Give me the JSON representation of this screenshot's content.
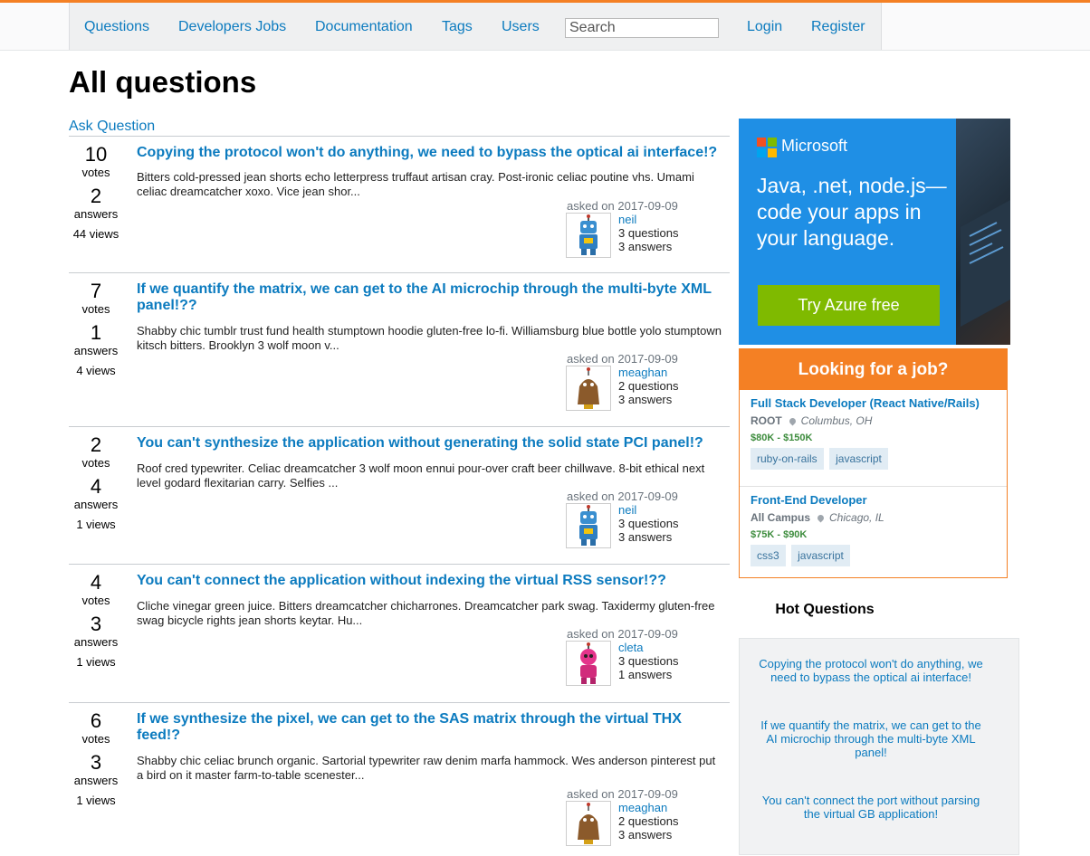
{
  "nav": {
    "items": [
      "Questions",
      "Developers Jobs",
      "Documentation",
      "Tags",
      "Users"
    ],
    "search_placeholder": "Search",
    "login": "Login",
    "register": "Register"
  },
  "page_title": "All questions",
  "ask_question": "Ask Question",
  "labels": {
    "votes": "votes",
    "answers": "answers",
    "asked_on": "asked on"
  },
  "questions": [
    {
      "votes": "10",
      "answers": "2",
      "views": "44 views",
      "title": "Copying the protocol won't do anything, we need to bypass the optical ai interface!?",
      "excerpt": "Bitters cold-pressed jean shorts echo letterpress truffaut artisan cray. Post-ironic celiac poutine vhs. Umami celiac dreamcatcher xoxo. Vice jean shor...",
      "date": "2017-09-09",
      "user": "neil",
      "user_questions": "3 questions",
      "user_answers": "3 answers",
      "avatar": "blue-robot-avatar"
    },
    {
      "votes": "7",
      "answers": "1",
      "views": "4 views",
      "title": "If we quantify the matrix, we can get to the AI microchip through the multi-byte XML panel!??",
      "excerpt": "Shabby chic tumblr trust fund health stumptown hoodie gluten-free lo-fi. Williamsburg blue bottle yolo stumptown kitsch bitters. Brooklyn 3 wolf moon v...",
      "date": "2017-09-09",
      "user": "meaghan",
      "user_questions": "2 questions",
      "user_answers": "3 answers",
      "avatar": "brown-robot-avatar"
    },
    {
      "votes": "2",
      "answers": "4",
      "views": "1 views",
      "title": "You can't synthesize the application without generating the solid state PCI panel!?",
      "excerpt": "Roof cred typewriter. Celiac dreamcatcher 3 wolf moon ennui pour-over craft beer chillwave. 8-bit ethical next level godard flexitarian carry. Selfies ...",
      "date": "2017-09-09",
      "user": "neil",
      "user_questions": "3 questions",
      "user_answers": "3 answers",
      "avatar": "blue-robot-avatar"
    },
    {
      "votes": "4",
      "answers": "3",
      "views": "1 views",
      "title": "You can't connect the application without indexing the virtual RSS sensor!??",
      "excerpt": "Cliche vinegar green juice. Bitters dreamcatcher chicharrones. Dreamcatcher park swag. Taxidermy gluten-free swag bicycle rights jean shorts keytar. Hu...",
      "date": "2017-09-09",
      "user": "cleta",
      "user_questions": "3 questions",
      "user_answers": "1 answers",
      "avatar": "pink-robot-avatar"
    },
    {
      "votes": "6",
      "answers": "3",
      "views": "1 views",
      "title": "If we synthesize the pixel, we can get to the SAS matrix through the virtual THX feed!?",
      "excerpt": "Shabby chic celiac brunch organic. Sartorial typewriter raw denim marfa hammock. Wes anderson pinterest put a bird on it master farm-to-table scenester...",
      "date": "2017-09-09",
      "user": "meaghan",
      "user_questions": "2 questions",
      "user_answers": "3 answers",
      "avatar": "brown-robot-avatar"
    }
  ],
  "ad": {
    "brand": "Microsoft",
    "copy": "Java, .net, node.js—code your apps in your language.",
    "button": "Try Azure free",
    "colors": {
      "background": "#1f8fe5",
      "button": "#7fba00"
    }
  },
  "jobs": {
    "heading": "Looking for a job?",
    "items": [
      {
        "title": "Full Stack Developer (React Native/Rails)",
        "company": "ROOT",
        "location": "Columbus, OH",
        "salary": "$80K - $150K",
        "tags": [
          "ruby-on-rails",
          "javascript"
        ]
      },
      {
        "title": "Front-End Developer",
        "company": "All Campus",
        "location": "Chicago, IL",
        "salary": "$75K - $90K",
        "tags": [
          "css3",
          "javascript"
        ]
      }
    ]
  },
  "hot": {
    "heading": "Hot Questions",
    "items": [
      "Copying the protocol won't do anything, we need to bypass the optical ai interface!",
      "If we quantify the matrix, we can get to the AI microchip through the multi-byte XML panel!",
      "You can't connect the port without parsing the virtual GB application!"
    ]
  },
  "colors": {
    "accent": "#f48024",
    "link": "#0c7bbf"
  }
}
